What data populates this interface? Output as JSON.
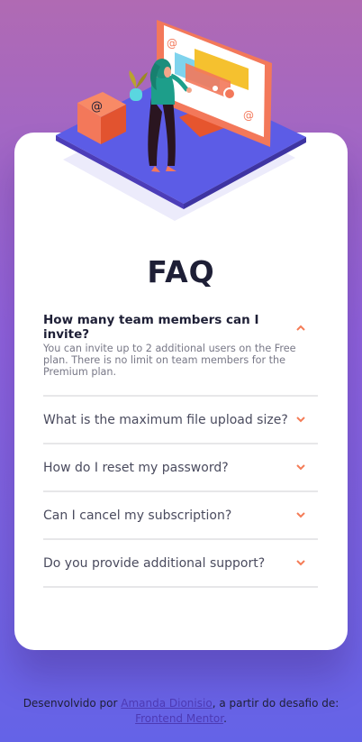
{
  "faq": {
    "title": "FAQ",
    "items": [
      {
        "question": "How many team members can I invite?",
        "answer": "You can invite up to 2 additional users on the Free plan. There is no limit on team members for the Premium plan.",
        "expanded": true
      },
      {
        "question": "What is the maximum file upload size?",
        "expanded": false
      },
      {
        "question": "How do I reset my password?",
        "expanded": false
      },
      {
        "question": "Can I cancel my subscription?",
        "expanded": false
      },
      {
        "question": "Do you provide additional support?",
        "expanded": false
      }
    ]
  },
  "footer": {
    "prefix": "Desenvolvido por ",
    "author_link": "Amanda Dionisio",
    "middle": ", a partir do desafio de:",
    "challenge_link": "Frontend Mentor",
    "suffix": "."
  },
  "colors": {
    "background_top": "#b06ab3",
    "background_bottom": "#6463e7",
    "accent_chevron": "#f47c57",
    "title_text": "#1e1f36",
    "answer_text": "#787887",
    "divider": "#e7e7e9"
  },
  "icons": {
    "chevron_open": "chevron-up-icon",
    "chevron_closed": "chevron-down-icon"
  }
}
